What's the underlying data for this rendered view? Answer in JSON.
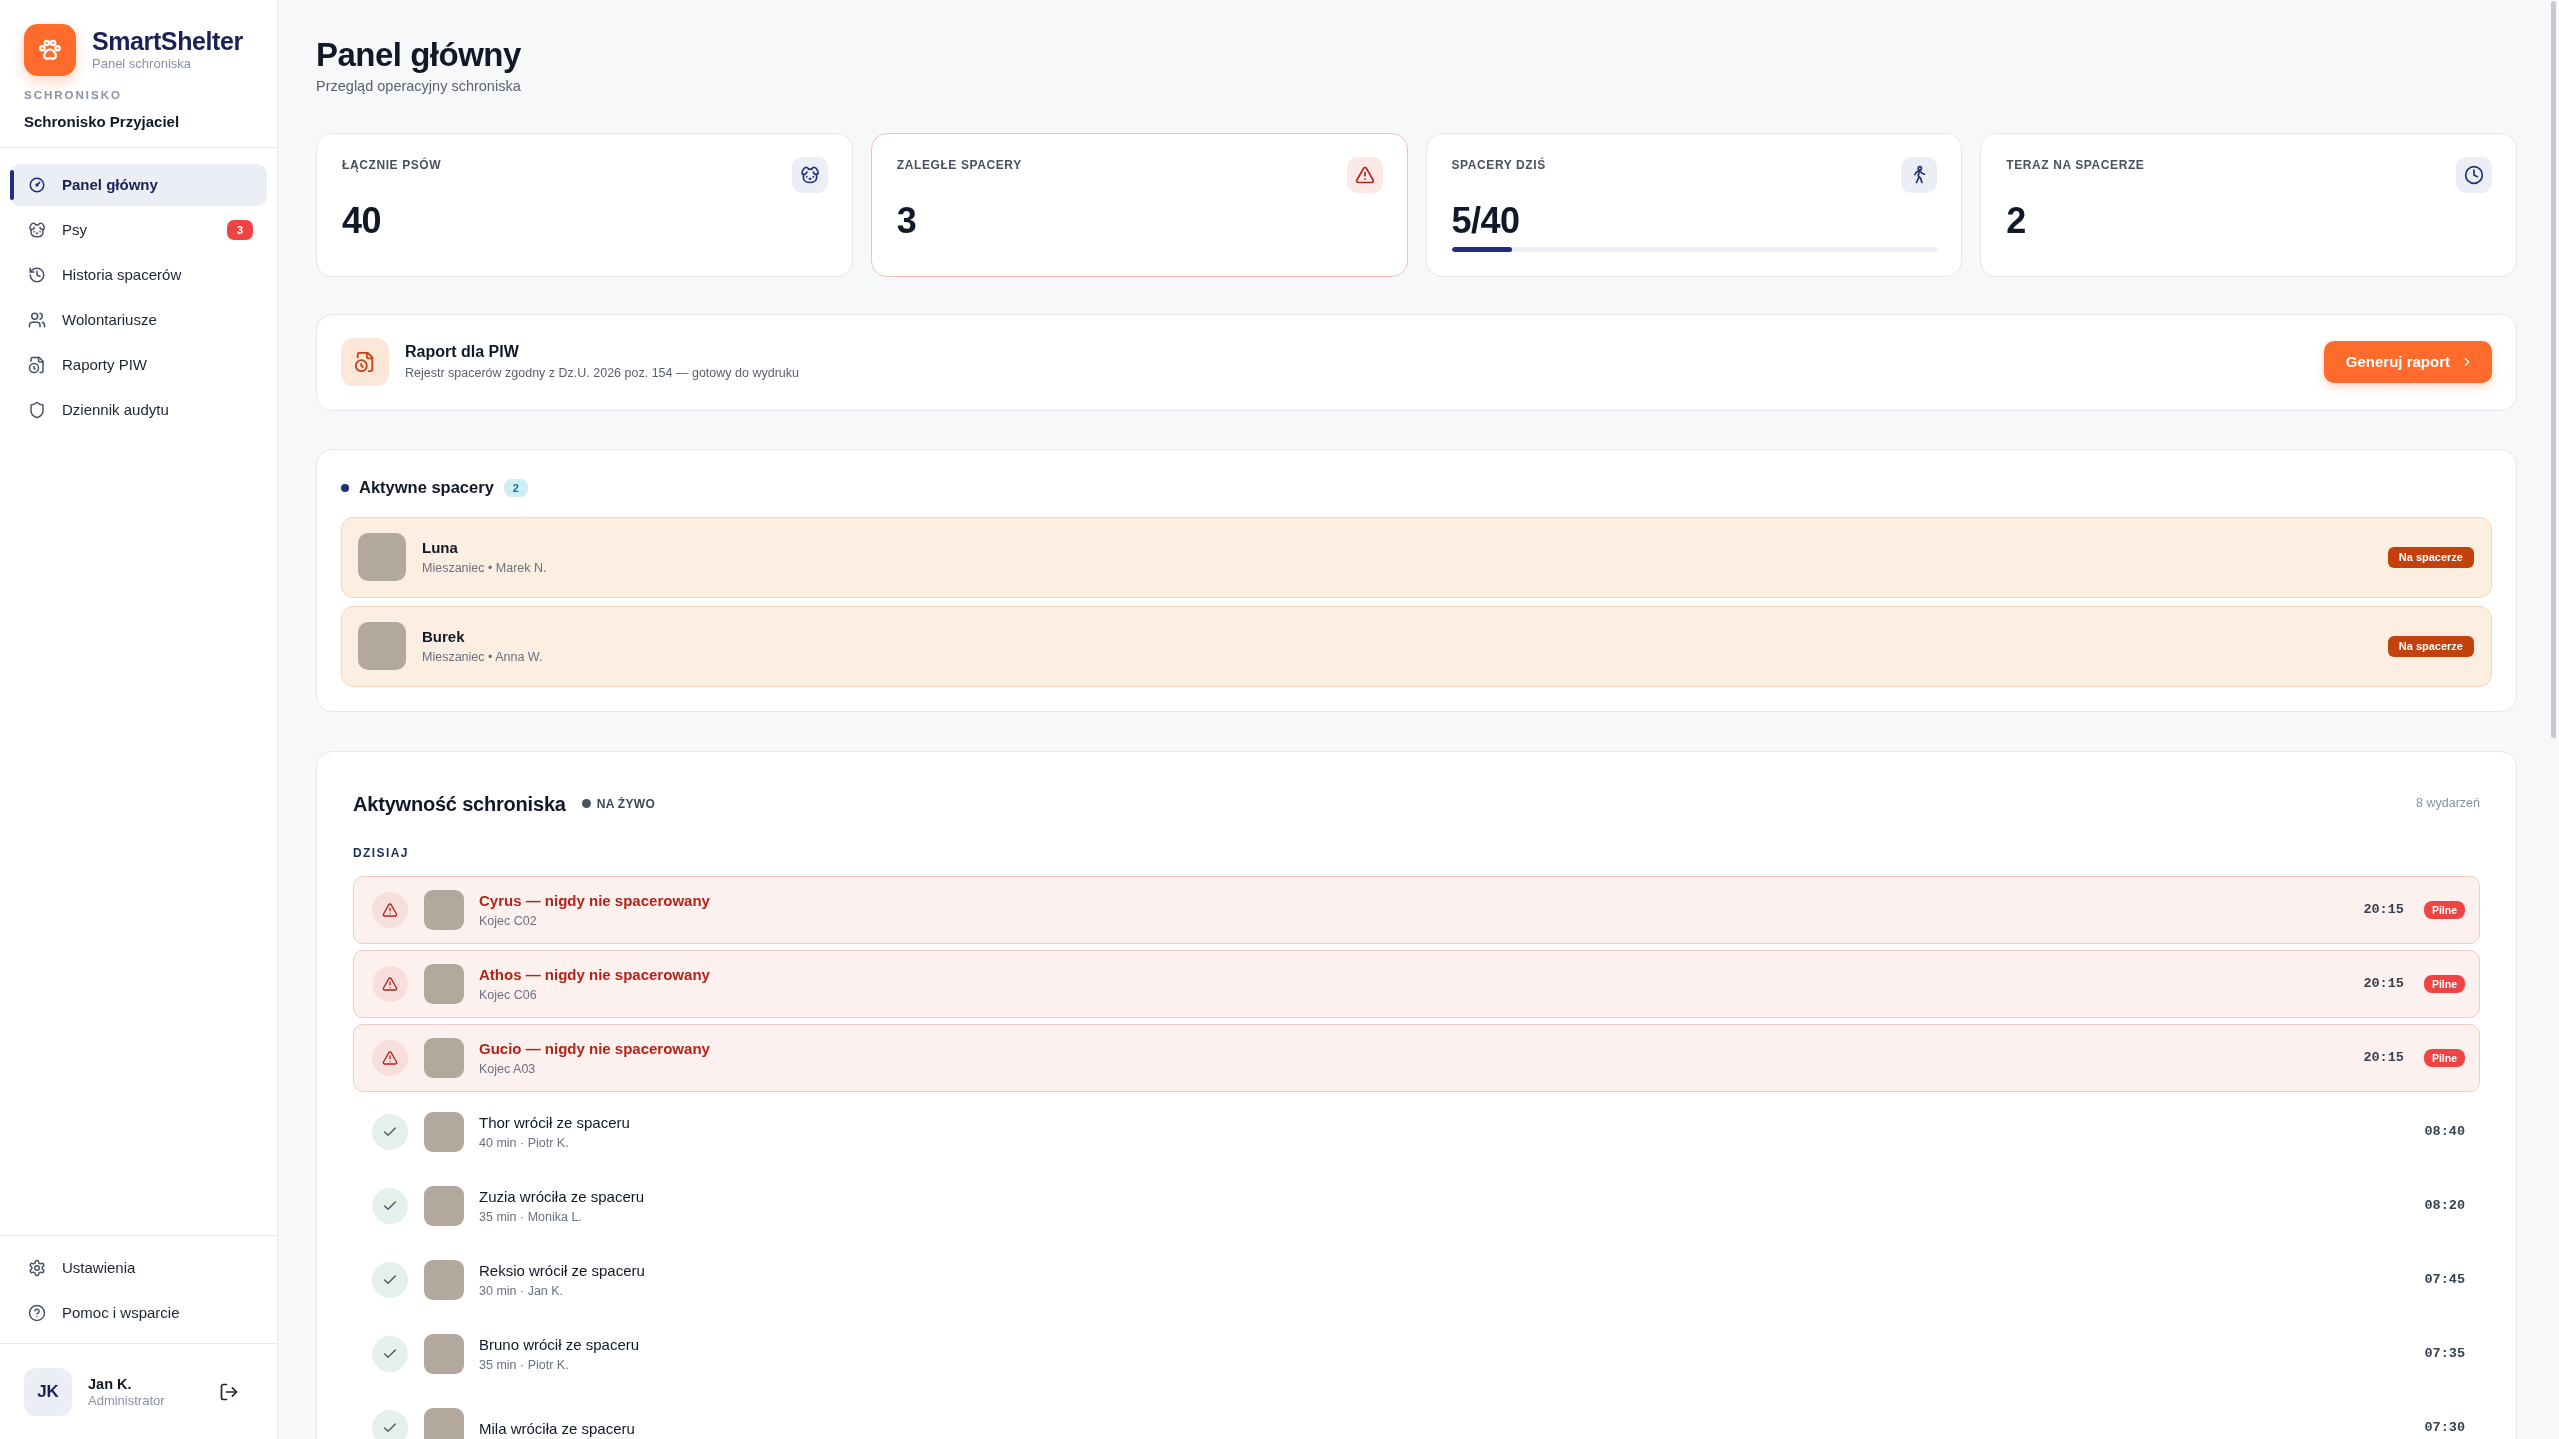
{
  "sidebar": {
    "brand": {
      "name": "SmartShelter",
      "subtitle": "Panel schroniska"
    },
    "shelter_label": "SCHRONISKO",
    "shelter_name": "Schronisko Przyjaciel",
    "nav": [
      {
        "label": "Panel główny",
        "selected": true
      },
      {
        "label": "Psy",
        "selected": false,
        "badge": "3"
      },
      {
        "label": "Historia spacerów",
        "selected": false
      },
      {
        "label": "Wolontariusze",
        "selected": false
      },
      {
        "label": "Raporty PIW",
        "selected": false
      },
      {
        "label": "Dziennik audytu",
        "selected": false
      }
    ],
    "footer_nav": [
      {
        "label": "Ustawienia",
        "selected": false
      },
      {
        "label": "Pomoc i wsparcie",
        "selected": false
      }
    ],
    "user": {
      "initials": "JK",
      "name": "Jan K.",
      "role": "Administrator"
    }
  },
  "header": {
    "title": "Panel główny",
    "subtitle": "Przegląd operacyjny schroniska"
  },
  "stats": [
    {
      "kind": "count",
      "label": "ŁĄCZNIE PSÓW",
      "value": "40"
    },
    {
      "kind": "alert",
      "label": "ZALEGŁE SPACERY",
      "value": "3"
    },
    {
      "kind": "progress",
      "label": "SPACERY DZIŚ",
      "value": "5/40",
      "level": 0.125
    },
    {
      "kind": "count",
      "label": "TERAZ NA SPACERZE",
      "value": "2"
    }
  ],
  "report": {
    "title": "Raport dla PIW",
    "description": "Rejestr spacerów zgodny z Dz.U. 2026 poz. 154 — gotowy do wydruku",
    "button": "Generuj raport"
  },
  "active_walks": {
    "title": "Aktywne spacery",
    "count": "2",
    "items": [
      {
        "name": "Luna",
        "details": "Mieszaniec • Marek N.",
        "status": "Na spacerze"
      },
      {
        "name": "Burek",
        "details": "Mieszaniec • Anna W.",
        "status": "Na spacerze"
      }
    ]
  },
  "activity": {
    "title": "Aktywność schroniska",
    "live_label": "NA ŻYWO",
    "count": "8 wydarzeń",
    "groups": [
      {
        "label": "DZISIAJ",
        "events": [
          {
            "kind": "urgent",
            "title": "Cyrus — nigdy nie spacerowany",
            "details": "Kojec C02",
            "time": "20:15",
            "badge": "Pilne"
          },
          {
            "kind": "urgent",
            "title": "Athos — nigdy nie spacerowany",
            "details": "Kojec C06",
            "time": "20:15",
            "badge": "Pilne"
          },
          {
            "kind": "urgent",
            "title": "Gucio — nigdy nie spacerowany",
            "details": "Kojec A03",
            "time": "20:15",
            "badge": "Pilne"
          },
          {
            "kind": "returned",
            "title": "Thor wrócił ze spaceru",
            "details": "40 min · Piotr K.",
            "time": "08:40"
          },
          {
            "kind": "returned",
            "title": "Zuzia wróciła ze spaceru",
            "details": "35 min · Monika L.",
            "time": "08:20"
          },
          {
            "kind": "returned",
            "title": "Reksio wrócił ze spaceru",
            "details": "30 min · Jan K.",
            "time": "07:45"
          },
          {
            "kind": "returned",
            "title": "Bruno wrócił ze spaceru",
            "details": "35 min · Piotr K.",
            "time": "07:35"
          },
          {
            "kind": "returned",
            "title": "Mila wróciła ze spaceru",
            "time": "07:30"
          }
        ]
      }
    ]
  }
}
